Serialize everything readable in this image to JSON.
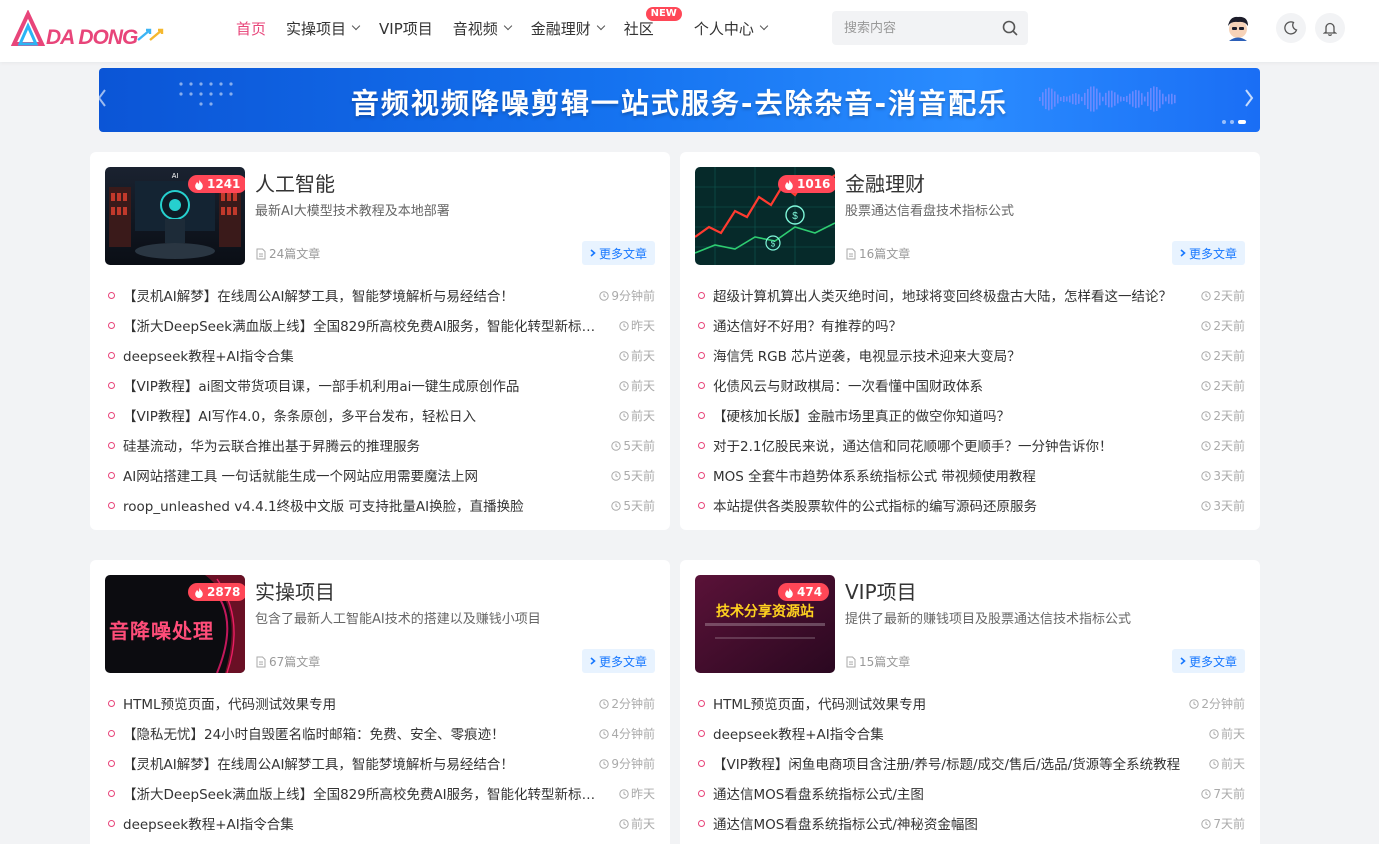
{
  "header": {
    "logo": "DA DONG",
    "nav": [
      {
        "label": "首页",
        "active": true,
        "caret": false
      },
      {
        "label": "实操项目",
        "caret": true
      },
      {
        "label": "VIP项目",
        "caret": false
      },
      {
        "label": "音视频",
        "caret": true
      },
      {
        "label": "金融理财",
        "caret": true
      },
      {
        "label": "社区",
        "caret": false,
        "badge": "NEW"
      },
      {
        "label": "个人中心",
        "caret": true
      }
    ],
    "search_placeholder": "搜索内容",
    "icons": [
      "search-icon",
      "moon-icon",
      "bell-icon"
    ]
  },
  "banner": {
    "title": "音频视频降噪剪辑一站式服务-去除杂音-消音配乐"
  },
  "cards": [
    {
      "title": "人工智能",
      "desc": "最新AI大模型技术教程及本地部署",
      "hot": "1241",
      "count": "24篇文章",
      "more": "更多文章",
      "thumb_text": "",
      "items": [
        {
          "text": "【灵机AI解梦】在线周公AI解梦工具，智能梦境解析与易经结合！",
          "time": "9分钟前"
        },
        {
          "text": "【浙大DeepSeek满血版上线】全国829所高校免费AI服务，智能化转型新标杆！",
          "time": "昨天"
        },
        {
          "text": "deepseek教程+AI指令合集",
          "time": "前天"
        },
        {
          "text": "【VIP教程】ai图文带货项目课，一部手机利用ai一键生成原创作品",
          "time": "前天"
        },
        {
          "text": "【VIP教程】AI写作4.0，条条原创，多平台发布，轻松日入",
          "time": "前天"
        },
        {
          "text": "硅基流动，华为云联合推出基于昇腾云的推理服务",
          "time": "5天前"
        },
        {
          "text": "AI网站搭建工具 一句话就能生成一个网站应用需要魔法上网",
          "time": "5天前"
        },
        {
          "text": "roop_unleashed v4.4.1终极中文版 可支持批量AI换脸，直播换脸",
          "time": "5天前"
        }
      ]
    },
    {
      "title": "金融理财",
      "desc": "股票通达信看盘技术指标公式",
      "hot": "1016",
      "count": "16篇文章",
      "more": "更多文章",
      "thumb_text": "",
      "items": [
        {
          "text": "超级计算机算出人类灭绝时间，地球将变回终极盘古大陆，怎样看这一结论？",
          "time": "2天前"
        },
        {
          "text": "通达信好不好用？有推荐的吗？",
          "time": "2天前"
        },
        {
          "text": "海信凭 RGB 芯片逆袭，电视显示技术迎来大变局？",
          "time": "2天前"
        },
        {
          "text": "化债风云与财政棋局：一次看懂中国财政体系",
          "time": "2天前"
        },
        {
          "text": "【硬核加长版】金融市场里真正的做空你知道吗？",
          "time": "2天前"
        },
        {
          "text": "对于2.1亿股民来说，通达信和同花顺哪个更顺手？一分钟告诉你！",
          "time": "2天前"
        },
        {
          "text": "MOS 全套牛市趋势体系系统指标公式 带视频使用教程",
          "time": "3天前"
        },
        {
          "text": "本站提供各类股票软件的公式指标的编写源码还原服务",
          "time": "3天前"
        }
      ]
    },
    {
      "title": "实操项目",
      "desc": "包含了最新人工智能AI技术的搭建以及赚钱小项目",
      "hot": "2878",
      "count": "67篇文章",
      "more": "更多文章",
      "thumb_text": "音降噪处理",
      "items": [
        {
          "text": "HTML预览页面，代码测试效果专用",
          "time": "2分钟前"
        },
        {
          "text": "【隐私无忧】24小时自毁匿名临时邮箱：免费、安全、零痕迹！",
          "time": "4分钟前"
        },
        {
          "text": "【灵机AI解梦】在线周公AI解梦工具，智能梦境解析与易经结合！",
          "time": "9分钟前"
        },
        {
          "text": "【浙大DeepSeek满血版上线】全国829所高校免费AI服务，智能化转型新标杆！",
          "time": "昨天"
        },
        {
          "text": "deepseek教程+AI指令合集",
          "time": "前天"
        }
      ]
    },
    {
      "title": "VIP项目",
      "desc": "提供了最新的赚钱项目及股票通达信技术指标公式",
      "hot": "474",
      "count": "15篇文章",
      "more": "更多文章",
      "thumb_text": "技术分享资源站",
      "items": [
        {
          "text": "HTML预览页面，代码测试效果专用",
          "time": "2分钟前"
        },
        {
          "text": "deepseek教程+AI指令合集",
          "time": "前天"
        },
        {
          "text": "【VIP教程】闲鱼电商项目含注册/养号/标题/成交/售后/选品/货源等全系统教程",
          "time": "前天"
        },
        {
          "text": "通达信MOS看盘系统指标公式/主图",
          "time": "7天前"
        },
        {
          "text": "通达信MOS看盘系统指标公式/神秘资金幅图",
          "time": "7天前"
        }
      ]
    }
  ]
}
